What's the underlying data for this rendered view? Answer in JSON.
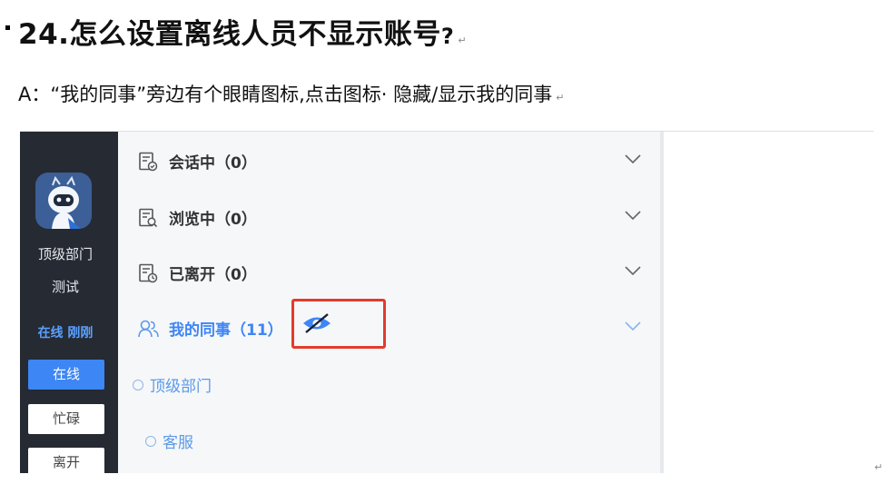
{
  "doc": {
    "heading_main": "24.怎么设置离线人员不显示账号",
    "heading_q": "?",
    "answer": "A：“我的同事”旁边有个眼睛图标,点击图标· 隐藏/显示我的同事",
    "para_mark": "↵"
  },
  "app": {
    "sidebar": {
      "dept_name": "顶级部门",
      "user_name": "测试",
      "status_text": "在线 刚刚",
      "buttons": [
        "在线",
        "忙碌",
        "离开"
      ]
    },
    "sections": [
      {
        "label": "会话中（0）",
        "icon": "chat-doc-icon"
      },
      {
        "label": "浏览中（0）",
        "icon": "browse-doc-icon"
      },
      {
        "label": "已离开（0）",
        "icon": "left-doc-icon"
      }
    ],
    "colleagues": {
      "label": "我的同事（11）",
      "icon": "colleagues-icon",
      "toggle_icon": "eye-hidden-icon"
    },
    "groups": [
      "顶级部门",
      "客服"
    ],
    "colors": {
      "accent": "#3d86f5",
      "sidebar": "#252a33",
      "highlight": "#e23b2e"
    }
  }
}
